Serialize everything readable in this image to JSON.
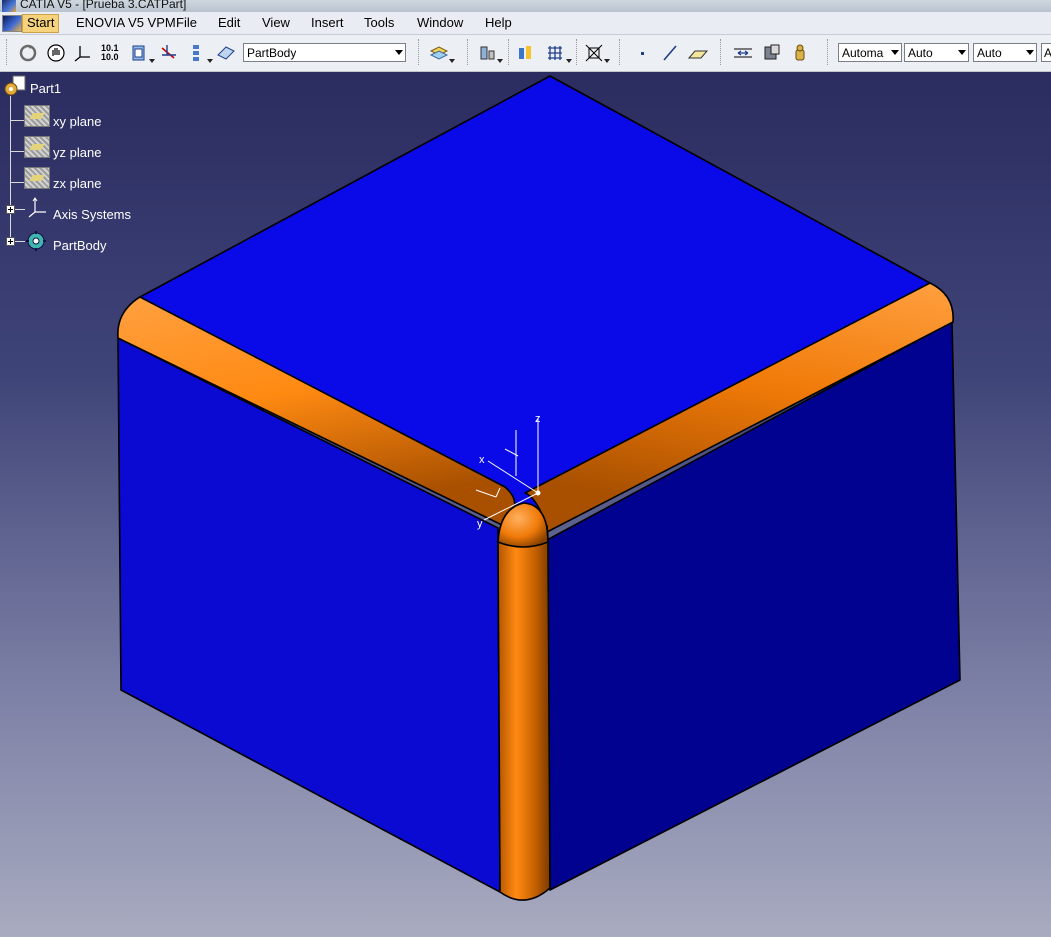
{
  "window": {
    "title": "CATIA V5 - [Prueba 3.CATPart]"
  },
  "menu": {
    "items": [
      "Start",
      "ENOVIA V5 VPM",
      "File",
      "Edit",
      "View",
      "Insert",
      "Tools",
      "Window",
      "Help"
    ]
  },
  "toolbar": {
    "body_selector": "PartBody",
    "combo_1": "Automa",
    "combo_2": "Auto",
    "combo_3": "Auto",
    "combo_4": "A",
    "icons": [
      "update-icon",
      "hand-icon",
      "formula-icon",
      "axis-system-icon",
      "sketch-icon",
      "line-normal-icon",
      "hierarchy-icon",
      "plane-icon",
      "layers-icon",
      "material-icon",
      "analysis-icon",
      "grid-icon",
      "snap-icon",
      "point-icon",
      "line-icon",
      "plane-tool-icon",
      "measure-icon",
      "save-icon",
      "inertia-icon"
    ]
  },
  "tree": {
    "root": "Part1",
    "items": [
      {
        "label": "xy plane"
      },
      {
        "label": "yz plane"
      },
      {
        "label": "zx plane"
      },
      {
        "label": "Axis Systems"
      },
      {
        "label": "PartBody"
      }
    ]
  },
  "axes": {
    "z": "z",
    "x": "x",
    "y": "y"
  },
  "colors": {
    "face": "#0000e6",
    "fillet": "#ff8a12",
    "selected_highlight": "#f6d37a"
  }
}
